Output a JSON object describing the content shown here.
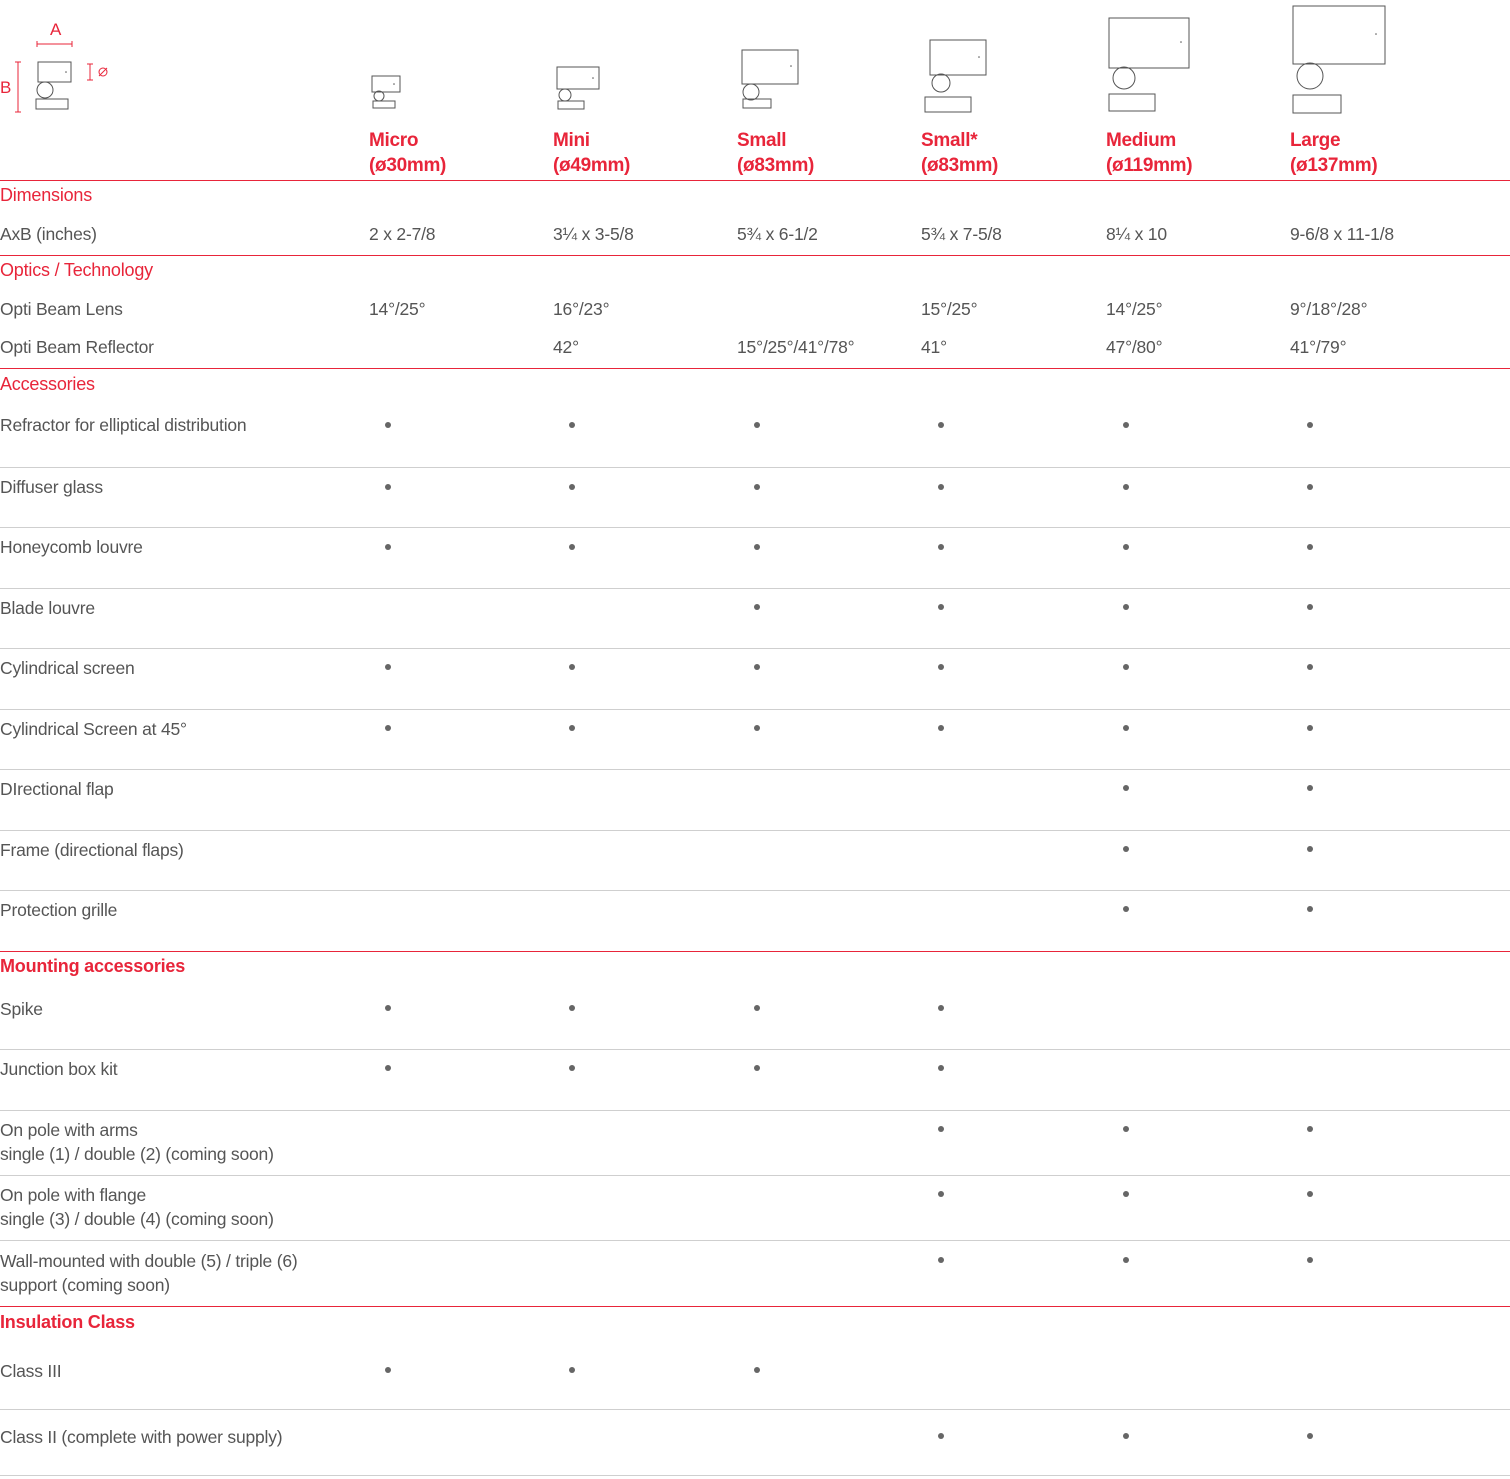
{
  "legend": {
    "a": "A",
    "b": "B"
  },
  "columns": [
    {
      "name": "Micro",
      "size": "(ø30mm)"
    },
    {
      "name": "Mini",
      "size": "(ø49mm)"
    },
    {
      "name": "Small",
      "size": "(ø83mm)"
    },
    {
      "name": "Small*",
      "size": "(ø83mm)"
    },
    {
      "name": "Medium",
      "size": "(ø119mm)"
    },
    {
      "name": "Large",
      "size": "(ø137mm)"
    }
  ],
  "sections": {
    "dimensions": "Dimensions",
    "optics": "Optics / Technology",
    "accessories": "Accessories",
    "mounting": "Mounting accessories",
    "insulation": "Insulation Class"
  },
  "dimensions": {
    "label": "AxB (inches)",
    "values": [
      "2 x 2-7/8",
      "3¼ x 3-5/8",
      "5¾ x 6-1/2",
      "5¾ x 7-5/8",
      "8¼ x 10",
      "9-6/8 x 11-1/8"
    ]
  },
  "optics": [
    {
      "label": "Opti Beam Lens",
      "values": [
        "14°/25°",
        "16°/23°",
        "",
        "15°/25°",
        "14°/25°",
        "9°/18°/28°"
      ]
    },
    {
      "label": "Opti Beam Reflector",
      "values": [
        "",
        "42°",
        "15°/25°/41°/78°",
        "41°",
        "47°/80°",
        "41°/79°"
      ]
    }
  ],
  "accessories": [
    {
      "label": "Refractor for elliptical distribution",
      "avail": [
        true,
        true,
        true,
        true,
        true,
        true
      ]
    },
    {
      "label": "Diffuser glass",
      "avail": [
        true,
        true,
        true,
        true,
        true,
        true
      ]
    },
    {
      "label": "Honeycomb louvre",
      "avail": [
        true,
        true,
        true,
        true,
        true,
        true
      ]
    },
    {
      "label": "Blade louvre",
      "avail": [
        false,
        false,
        true,
        true,
        true,
        true
      ]
    },
    {
      "label": "Cylindrical screen",
      "avail": [
        true,
        true,
        true,
        true,
        true,
        true
      ]
    },
    {
      "label": "Cylindrical Screen at 45°",
      "avail": [
        true,
        true,
        true,
        true,
        true,
        true
      ]
    },
    {
      "label": "DIrectional flap",
      "avail": [
        false,
        false,
        false,
        false,
        true,
        true
      ]
    },
    {
      "label": "Frame (directional flaps)",
      "avail": [
        false,
        false,
        false,
        false,
        true,
        true
      ]
    },
    {
      "label": "Protection grille",
      "avail": [
        false,
        false,
        false,
        false,
        true,
        true
      ]
    }
  ],
  "mounting": [
    {
      "label": "Spike",
      "label2": "",
      "avail": [
        true,
        true,
        true,
        true,
        false,
        false
      ]
    },
    {
      "label": "Junction box kit",
      "label2": "",
      "avail": [
        true,
        true,
        true,
        true,
        false,
        false
      ]
    },
    {
      "label": "On pole with arms",
      "label2": "single (1) / double (2) (coming soon)",
      "avail": [
        false,
        false,
        false,
        true,
        true,
        true
      ]
    },
    {
      "label": "On pole with flange",
      "label2": "single (3) / double (4) (coming soon)",
      "avail": [
        false,
        false,
        false,
        true,
        true,
        true
      ]
    },
    {
      "label": "Wall-mounted with double (5) / triple (6)",
      "label2": "support (coming soon)",
      "avail": [
        false,
        false,
        false,
        true,
        true,
        true
      ]
    }
  ],
  "insulation": [
    {
      "label": "Class III",
      "avail": [
        true,
        true,
        true,
        false,
        false,
        false
      ]
    },
    {
      "label": "Class II (complete with power supply)",
      "avail": [
        false,
        false,
        false,
        true,
        true,
        true
      ]
    }
  ],
  "colors": {
    "accent": "#e8253a",
    "text": "#555555",
    "divider": "#cfcfcf"
  }
}
